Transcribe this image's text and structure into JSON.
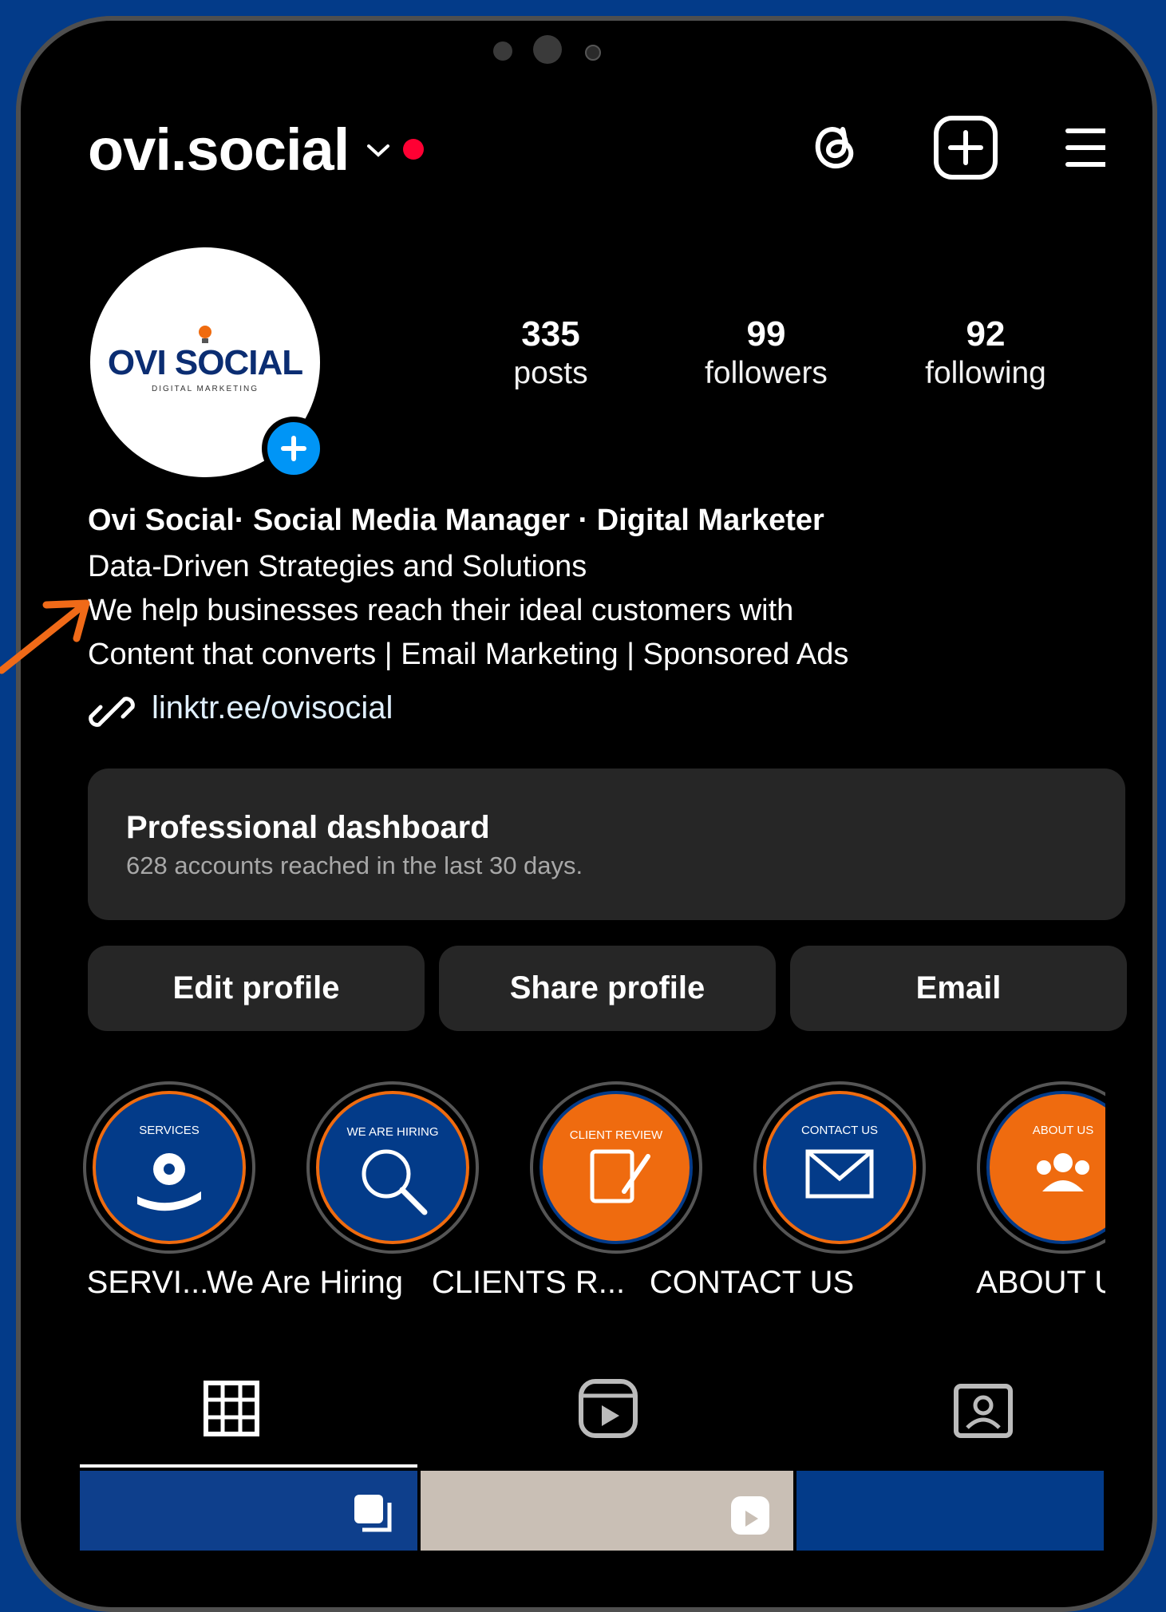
{
  "header": {
    "username": "ovi.social"
  },
  "avatar": {
    "logo_text": "OVI SOCIAL",
    "logo_sub": "DIGITAL MARKETING"
  },
  "stats": [
    {
      "value": "335",
      "label": "posts"
    },
    {
      "value": "99",
      "label": "followers"
    },
    {
      "value": "92",
      "label": "following"
    }
  ],
  "bio": {
    "name_line": "Ovi Social· Social Media Manager · Digital Marketer",
    "line1": "Data-Driven Strategies and Solutions",
    "line2": "We help businesses reach their ideal customers with",
    "line3": "Content that converts | Email Marketing | Sponsored Ads",
    "link": "linktr.ee/ovisocial"
  },
  "dashboard": {
    "title": "Professional dashboard",
    "subtitle": "628 accounts reached in the last 30 days."
  },
  "buttons": {
    "edit": "Edit profile",
    "share": "Share profile",
    "email": "Email"
  },
  "highlights": [
    {
      "label": "OUR SERVI...",
      "badge": "SERVICES"
    },
    {
      "label": "We Are Hiring",
      "badge": "WE ARE HIRING"
    },
    {
      "label": "CLIENTS R...",
      "badge": "CLIENT REVIEW"
    },
    {
      "label": "CONTACT US",
      "badge": "CONTACT US"
    },
    {
      "label": "ABOUT US",
      "badge": "ABOUT US"
    }
  ],
  "colors": {
    "background": "#033b89",
    "accent_orange": "#ef6b0f",
    "badge_blue": "#0095f6",
    "live_dot": "#ff0033"
  }
}
